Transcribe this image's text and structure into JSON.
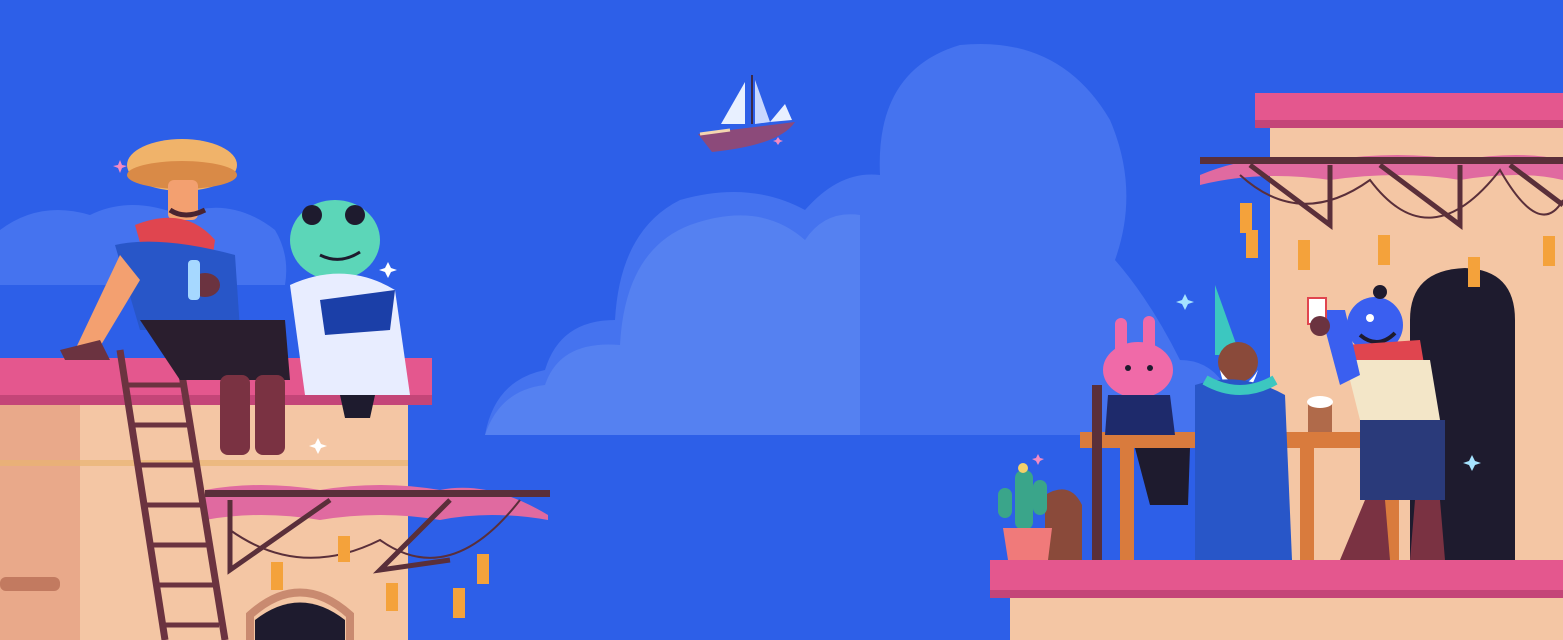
{
  "scene": {
    "description_label": "",
    "colors": {
      "sky": "#2d5fe8",
      "cloud_back": "#4573ef",
      "cloud_mid": "#5b85f2",
      "cloud_front": "#6a93f5",
      "building_light": "#f4c6a4",
      "building_mid": "#e9a98a",
      "roof_pink": "#e4578e",
      "roof_pink_dark": "#c44578",
      "awning": "#d64d86",
      "wood_dark": "#5a2f3a",
      "wood": "#8a4a3a",
      "doorway": "#1e1b2e",
      "lantern": "#f4a23b",
      "table": "#d97b3d",
      "sparkle": "#a6e3ff"
    },
    "icons": [
      "sailing-ship-icon",
      "mushroom-hat-character-icon",
      "frog-reader-character-icon",
      "pink-bunny-character-icon",
      "wizard-character-icon",
      "blue-genie-character-icon",
      "cactus-plant-icon",
      "ladder-icon",
      "lantern-icon",
      "sparkle-icon"
    ]
  }
}
